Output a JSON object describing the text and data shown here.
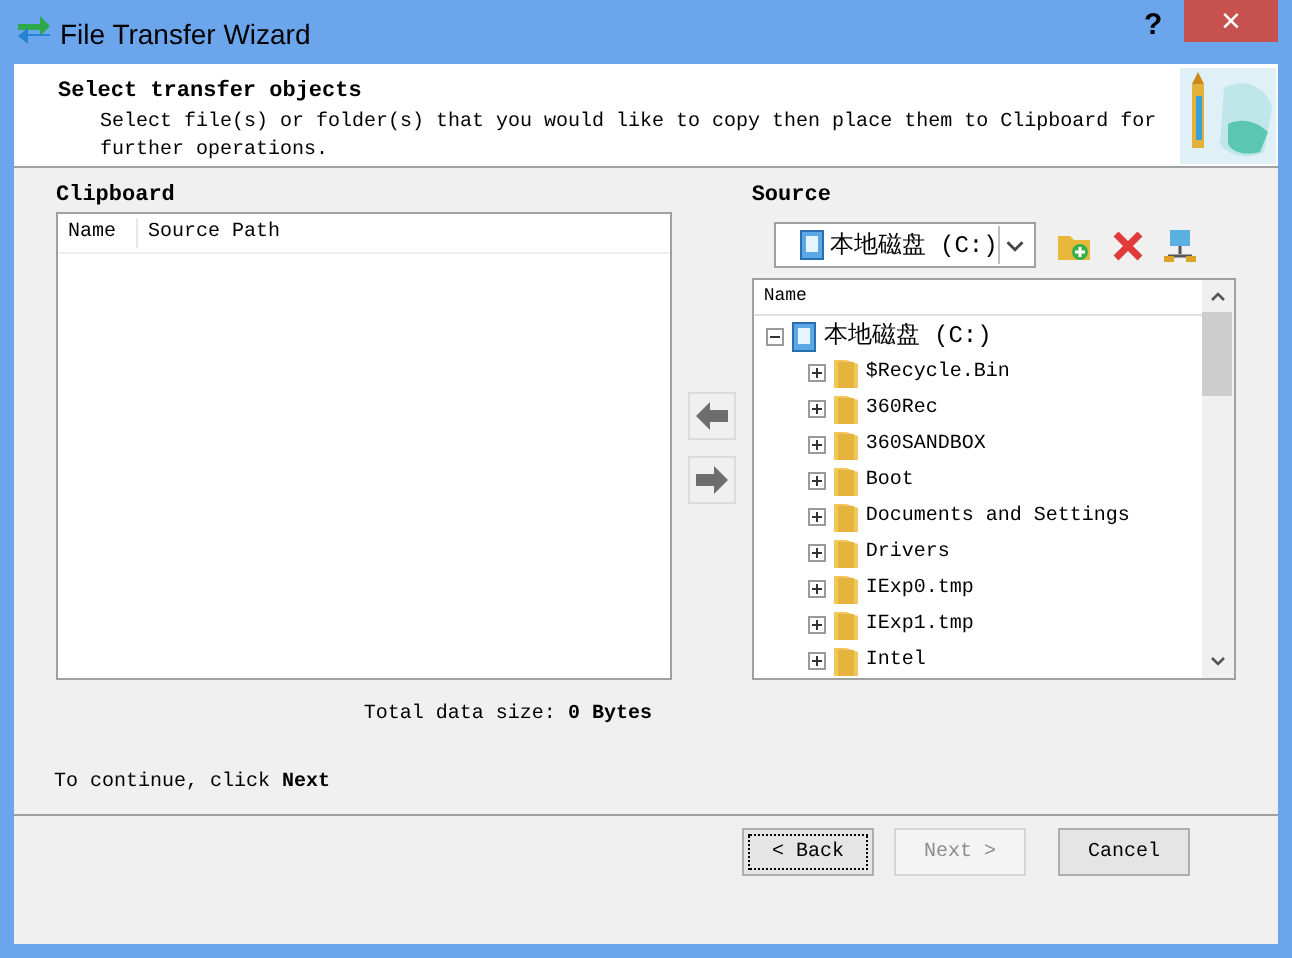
{
  "window": {
    "title": "File Transfer Wizard",
    "help": "?",
    "close": "×"
  },
  "header": {
    "title": "Select transfer objects",
    "description": "Select file(s) or folder(s) that you would like to copy then place them to Clipboard for further operations."
  },
  "clipboard": {
    "label": "Clipboard",
    "columns": [
      "Name",
      "Source Path"
    ],
    "total_label": "Total data size:",
    "total_value": "0 Bytes"
  },
  "source": {
    "label": "Source",
    "drive": "本地磁盘 (C:)",
    "column": "Name",
    "tree": [
      {
        "kind": "drive",
        "label": "本地磁盘 (C:)",
        "expanded": true,
        "children": [
          {
            "kind": "folder",
            "label": "$Recycle.Bin",
            "expanded": false
          },
          {
            "kind": "folder",
            "label": "360Rec",
            "expanded": false
          },
          {
            "kind": "folder",
            "label": "360SANDBOX",
            "expanded": false
          },
          {
            "kind": "folder",
            "label": "Boot",
            "expanded": false
          },
          {
            "kind": "folder",
            "label": "Documents and Settings",
            "expanded": false
          },
          {
            "kind": "folder",
            "label": "Drivers",
            "expanded": false
          },
          {
            "kind": "folder",
            "label": "IExp0.tmp",
            "expanded": false
          },
          {
            "kind": "folder",
            "label": "IExp1.tmp",
            "expanded": false
          },
          {
            "kind": "folder",
            "label": "Intel",
            "expanded": false
          }
        ]
      }
    ]
  },
  "instruction": "To continue, click **Next**",
  "buttons": [
    {
      "label": "< Back",
      "disabled": false,
      "focused": true
    },
    {
      "label": "Next >",
      "disabled": true,
      "focused": false
    },
    {
      "label": "Cancel",
      "disabled": false,
      "focused": false
    }
  ]
}
